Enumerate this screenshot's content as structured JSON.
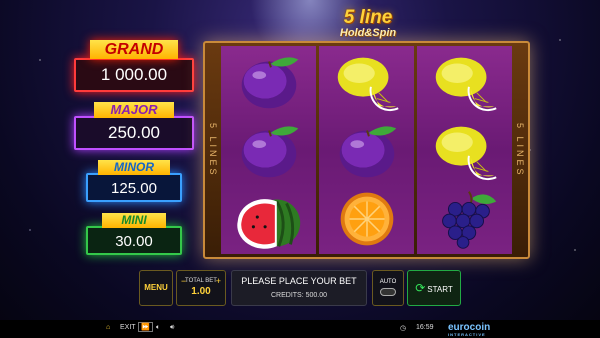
{
  "logo": {
    "line1": "5 line",
    "line2": "Hold&Spin"
  },
  "jackpots": {
    "grand": {
      "label": "GRAND",
      "value": "1 000.00"
    },
    "major": {
      "label": "MAJOR",
      "value": "250.00"
    },
    "minor": {
      "label": "MINOR",
      "value": "125.00"
    },
    "mini": {
      "label": "MINI",
      "value": "30.00"
    }
  },
  "reels": {
    "side_label": "5 LINES",
    "columns": [
      [
        "plum-icon",
        "plum-icon",
        "watermelon-icon"
      ],
      [
        "lemon-icon",
        "plum-icon",
        "orange-icon"
      ],
      [
        "lemon-icon",
        "lemon-icon",
        "grapes-icon"
      ]
    ]
  },
  "controls": {
    "menu": "MENU",
    "total_bet_label": "TOTAL BET",
    "total_bet_value": "1.00",
    "minus": "−",
    "plus": "+",
    "message": "PLEASE PLACE YOUR BET",
    "credits": "CREDITS: 500.00",
    "auto": "AUTO",
    "start": "START"
  },
  "footer": {
    "exit": "EXIT",
    "time": "16:59",
    "brand": "eurocoin",
    "brand_sub": "INTERACTIVE"
  },
  "colors": {
    "grand": "#ff3b3b",
    "major": "#c050ff",
    "minor": "#3aa0ff",
    "mini": "#34c84a",
    "accent": "#ffd23a"
  }
}
